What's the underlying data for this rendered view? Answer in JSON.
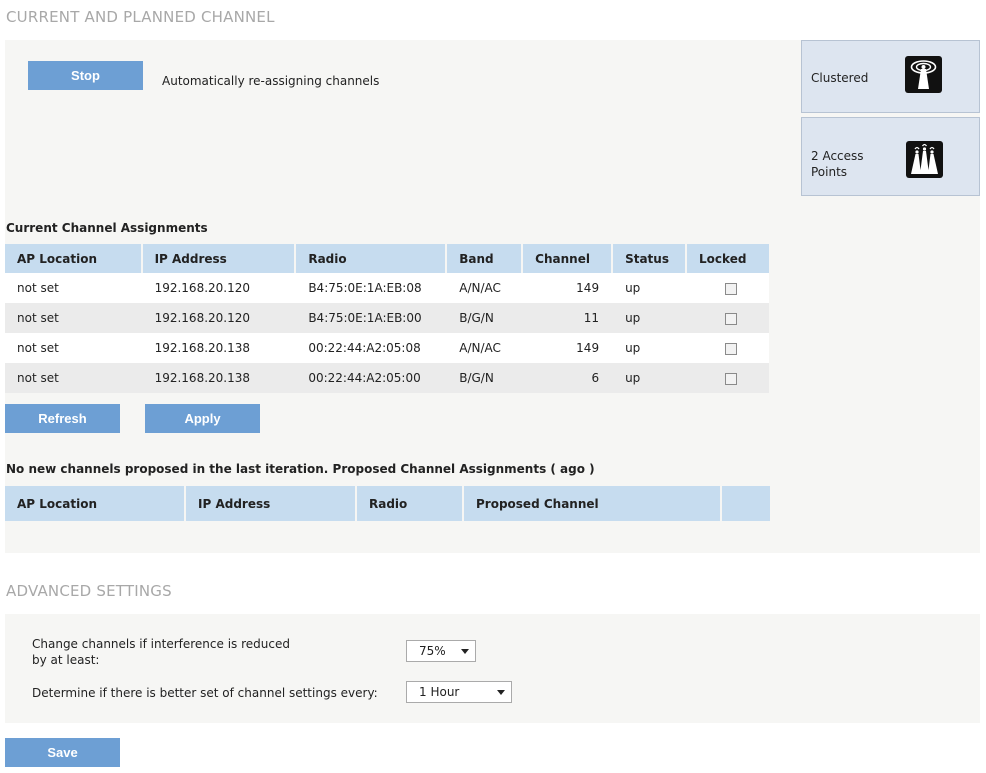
{
  "sections": {
    "current_title": "CURRENT AND PLANNED CHANNEL",
    "advanced_title": "ADVANCED SETTINGS"
  },
  "controls": {
    "stop_label": "Stop",
    "status_text": "Automatically re-assigning channels",
    "refresh_label": "Refresh",
    "apply_label": "Apply",
    "save_label": "Save"
  },
  "side_cards": {
    "clustered_label": "Clustered",
    "access_points_label": "2 Access Points"
  },
  "current_assignments": {
    "heading": "Current Channel Assignments",
    "columns": [
      "AP Location",
      "IP Address",
      "Radio",
      "Band",
      "Channel",
      "Status",
      "Locked"
    ],
    "rows": [
      {
        "location": "not set",
        "ip": "192.168.20.120",
        "radio": "B4:75:0E:1A:EB:08",
        "band": "A/N/AC",
        "channel": "149",
        "status": "up",
        "locked": false
      },
      {
        "location": "not set",
        "ip": "192.168.20.120",
        "radio": "B4:75:0E:1A:EB:00",
        "band": "B/G/N",
        "channel": "11",
        "status": "up",
        "locked": false
      },
      {
        "location": "not set",
        "ip": "192.168.20.138",
        "radio": "00:22:44:A2:05:08",
        "band": "A/N/AC",
        "channel": "149",
        "status": "up",
        "locked": false
      },
      {
        "location": "not set",
        "ip": "192.168.20.138",
        "radio": "00:22:44:A2:05:00",
        "band": "B/G/N",
        "channel": "6",
        "status": "up",
        "locked": false
      }
    ]
  },
  "proposed_assignments": {
    "heading": "No new channels proposed in the last iteration. Proposed Channel Assignments ( ago )",
    "columns": [
      "AP Location",
      "IP Address",
      "Radio",
      "Proposed Channel",
      ""
    ]
  },
  "advanced": {
    "interference_label": "Change channels if interference is reduced by at least:",
    "interference_value": "75%",
    "interval_label": "Determine if there is better set of channel settings every:",
    "interval_value": "1 Hour"
  },
  "colors": {
    "button": "#6d9fd4",
    "table_header": "#c6dcef",
    "panel": "#f6f6f4",
    "side_card": "#dde5f0"
  }
}
